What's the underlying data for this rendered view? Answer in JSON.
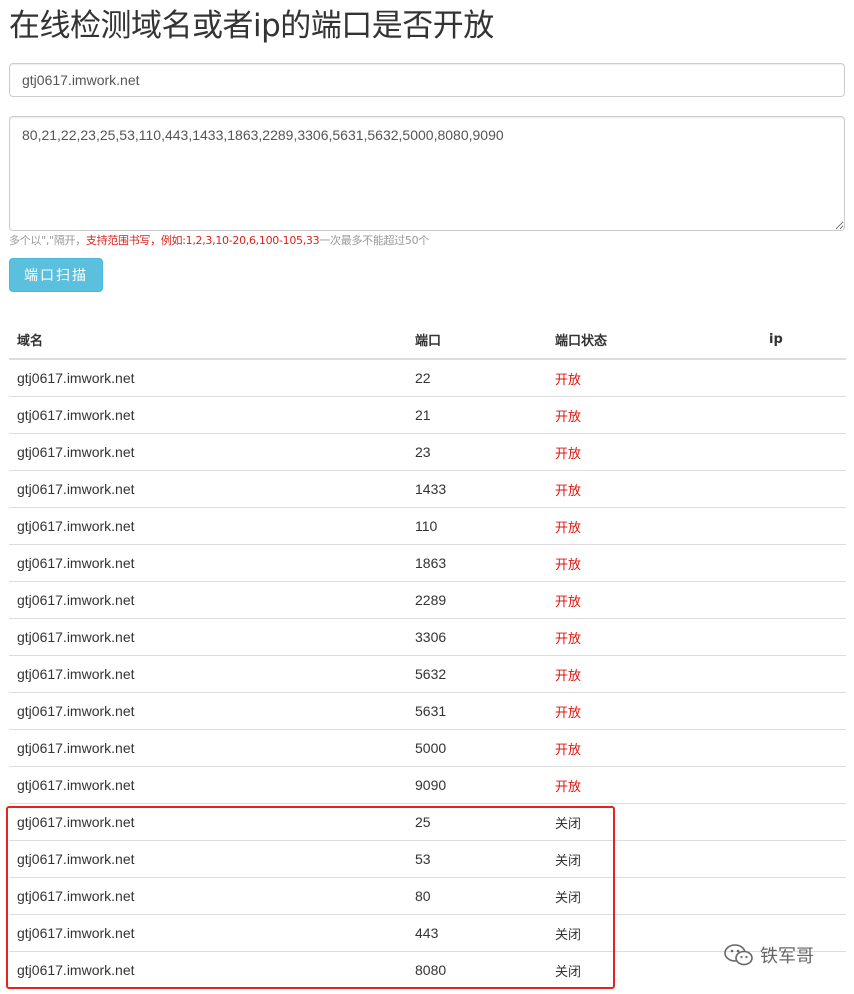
{
  "title": "在线检测域名或者ip的端口是否开放",
  "host_input": {
    "value": "gtj0617.imwork.net"
  },
  "ports_input": {
    "value": "80,21,22,23,25,53,110,443,1433,1863,2289,3306,5631,5632,5000,8080,9090"
  },
  "help": {
    "part1": "多个以\",\"隔开，",
    "part2": "支持范围书写，例如:1,2,3,10-20,6,100-105,33",
    "part3": "一次最多不能超过50个"
  },
  "scan_button": "端口扫描",
  "table": {
    "headers": [
      "域名",
      "端口",
      "端口状态",
      "ip"
    ],
    "rows": [
      {
        "domain": "gtj0617.imwork.net",
        "port": "22",
        "status": "开放",
        "state": "open"
      },
      {
        "domain": "gtj0617.imwork.net",
        "port": "21",
        "status": "开放",
        "state": "open"
      },
      {
        "domain": "gtj0617.imwork.net",
        "port": "23",
        "status": "开放",
        "state": "open"
      },
      {
        "domain": "gtj0617.imwork.net",
        "port": "1433",
        "status": "开放",
        "state": "open"
      },
      {
        "domain": "gtj0617.imwork.net",
        "port": "110",
        "status": "开放",
        "state": "open"
      },
      {
        "domain": "gtj0617.imwork.net",
        "port": "1863",
        "status": "开放",
        "state": "open"
      },
      {
        "domain": "gtj0617.imwork.net",
        "port": "2289",
        "status": "开放",
        "state": "open"
      },
      {
        "domain": "gtj0617.imwork.net",
        "port": "3306",
        "status": "开放",
        "state": "open"
      },
      {
        "domain": "gtj0617.imwork.net",
        "port": "5632",
        "status": "开放",
        "state": "open"
      },
      {
        "domain": "gtj0617.imwork.net",
        "port": "5631",
        "status": "开放",
        "state": "open"
      },
      {
        "domain": "gtj0617.imwork.net",
        "port": "5000",
        "status": "开放",
        "state": "open"
      },
      {
        "domain": "gtj0617.imwork.net",
        "port": "9090",
        "status": "开放",
        "state": "open"
      },
      {
        "domain": "gtj0617.imwork.net",
        "port": "25",
        "status": "关闭",
        "state": "closed"
      },
      {
        "domain": "gtj0617.imwork.net",
        "port": "53",
        "status": "关闭",
        "state": "closed"
      },
      {
        "domain": "gtj0617.imwork.net",
        "port": "80",
        "status": "关闭",
        "state": "closed"
      },
      {
        "domain": "gtj0617.imwork.net",
        "port": "443",
        "status": "关闭",
        "state": "closed"
      },
      {
        "domain": "gtj0617.imwork.net",
        "port": "8080",
        "status": "关闭",
        "state": "closed"
      }
    ]
  },
  "watermark": {
    "text": "铁军哥",
    "icon": "wechat-icon"
  },
  "colors": {
    "open": "#e0150f",
    "button": "#5bc0de",
    "highlight": "#e2241b"
  }
}
